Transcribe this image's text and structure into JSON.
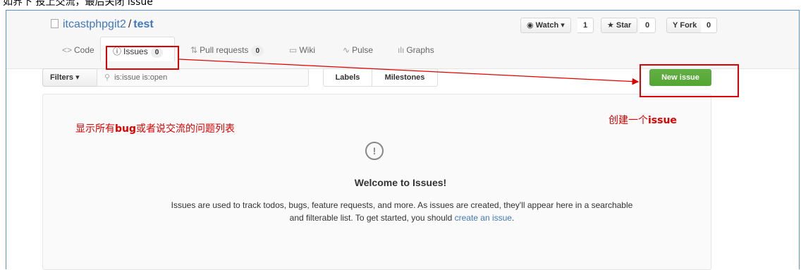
{
  "caption": "如界下 投上交流，最后关闭 issue",
  "repo": {
    "owner": "itcastphpgit2",
    "separator": "/",
    "name": "test"
  },
  "actions": {
    "watch_label": "Watch ▾",
    "watch_count": "1",
    "star_label": "Star",
    "star_count": "0",
    "fork_label": "Fork",
    "fork_count": "0"
  },
  "tabs": [
    {
      "label": "Code",
      "icon": "code-icon"
    },
    {
      "label": "Issues",
      "count": "0",
      "icon": "issue-opened-icon"
    },
    {
      "label": "Pull requests",
      "count": "0",
      "icon": "git-pull-request-icon"
    },
    {
      "label": "Wiki",
      "icon": "book-icon"
    },
    {
      "label": "Pulse",
      "icon": "pulse-icon"
    },
    {
      "label": "Graphs",
      "icon": "graph-icon"
    }
  ],
  "filters": {
    "button_label": "Filters ▾",
    "search_value": "is:issue is:open"
  },
  "labels_button": "Labels",
  "milestones_button": "Milestones",
  "new_issue_button": "New issue",
  "blankslate": {
    "title": "Welcome to Issues!",
    "text_1": "Issues are used to track todos, bugs, feature requests, and more. As issues are created, they'll appear here in a searchable",
    "text_2": "and filterable list. To get started, you should",
    "link": "create an issue",
    "text_end": "."
  },
  "annotations": {
    "list_note_a": "显示所有",
    "list_note_b": "bug",
    "list_note_c": "或者说交流的问题列表",
    "create_note_a": "创建一个",
    "create_note_b": "issue"
  },
  "colors": {
    "accent_link": "#4078c0",
    "success_green": "#55a532",
    "annotation_red": "#e00000"
  }
}
